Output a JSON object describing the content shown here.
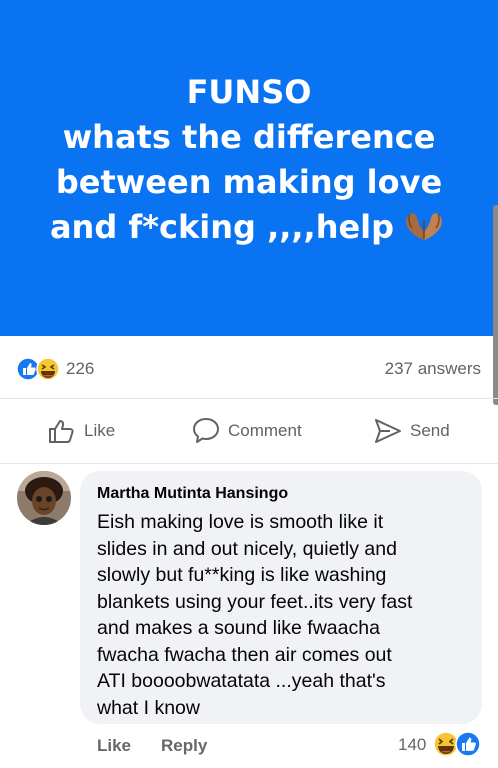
{
  "post": {
    "text": "FUNSO\nwhats the difference\nbetween making love\nand f*cking ,,,,help",
    "background_color": "#0a73f2",
    "emoji": "folded-hands-emoji"
  },
  "stats": {
    "reaction_count": "226",
    "answers": "237 answers",
    "reaction_icons": [
      "like-icon",
      "laughing-icon"
    ]
  },
  "actions": {
    "like_label": "Like",
    "comment_label": "Comment",
    "send_label": "Send"
  },
  "comment": {
    "author": "Martha Mutinta Hansingo",
    "text": "Eish making love is smooth like it\nslides in and out nicely, quietly and\nslowly but fu**king is like washing\nblankets using your feet..its very fast\nand makes a sound like fwaacha\nfwacha fwacha then air comes out\nATI boooobwatatata ...yeah that's\nwhat I know",
    "like_label": "Like",
    "reply_label": "Reply",
    "reaction_count": "140"
  }
}
